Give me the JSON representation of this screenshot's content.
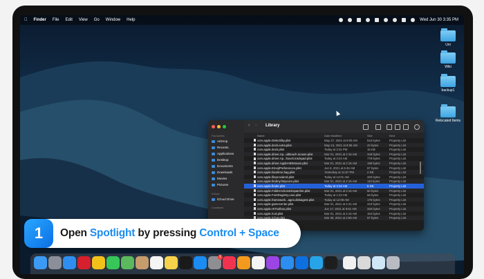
{
  "menubar": {
    "app": "Finder",
    "items": [
      "File",
      "Edit",
      "View",
      "Go",
      "Window",
      "Help"
    ],
    "clock": "Wed Jun 30  3:35 PM"
  },
  "desktop_icons": [
    {
      "label": "Uni"
    },
    {
      "label": "Wiki"
    },
    {
      "label": "backup1"
    },
    {
      "label": "Relocated Items"
    }
  ],
  "finder": {
    "title": "Library",
    "sidebar_headers": {
      "favourites": "Favourites",
      "icloud": "iCloud",
      "locations": "Locations"
    },
    "sidebar_items": [
      "AirDrop",
      "Recents",
      "Applications",
      "Desktop",
      "Documents",
      "Downloads",
      "Movies",
      "Pictures"
    ],
    "icloud_items": [
      "iCloud Drive"
    ],
    "columns": {
      "name": "Name",
      "date": "Date Modified",
      "size": "Size",
      "kind": "Kind"
    },
    "rows": [
      {
        "name": "com.apple.DiskUtility.plist",
        "date": "May 27, 2021 at 9:00 AM",
        "size": "516 bytes",
        "kind": "Property List"
      },
      {
        "name": "com.apple.dock.extra.plist",
        "date": "May 24, 2021 at 8:55 AM",
        "size": "42 bytes",
        "kind": "Property List"
      },
      {
        "name": "com.apple.dock.plist",
        "date": "Today at 3:31 PM",
        "size": "15 KB",
        "kind": "Property List"
      },
      {
        "name": "com.apple.driver.Ap...ultitouch.mouse.plist",
        "date": "Mar 01, 2021 at 2:16 AM",
        "size": "345 bytes",
        "kind": "Property List"
      },
      {
        "name": "com.apple.driver.Ap...ltouch.trackpad.plist",
        "date": "Today at 3:24 AM",
        "size": "778 bytes",
        "kind": "Property List"
      },
      {
        "name": "com.apple.driver.AppleHIDMouse.plist",
        "date": "Mar 01, 2021 at 2:16 AM",
        "size": "199 bytes",
        "kind": "Property List"
      },
      {
        "name": "com.apple.EmojiPreferences.plist",
        "date": "Jun 8, 2021 at 6:46 AM",
        "size": "97 bytes",
        "kind": "Property List"
      },
      {
        "name": "com.apple.facetime.bag.plist",
        "date": "Yesterday at 11:57 PM",
        "size": "2 KB",
        "kind": "Property List"
      },
      {
        "name": "com.apple.fileproviderd.plist",
        "date": "Today at 12:01 AM",
        "size": "320 bytes",
        "kind": "Property List"
      },
      {
        "name": "com.apple.findmy.fmipcore.plist",
        "date": "Mar 01, 2021 at 2:16 AM",
        "size": "110 bytes",
        "kind": "Property List"
      },
      {
        "name": "com.apple.finder.plist",
        "date": "Today at 3:34 AM",
        "size": "5 KB",
        "kind": "Property List",
        "selected": true
      },
      {
        "name": "com.apple.FolderActionsDispatcher.plist",
        "date": "Mar 01, 2021 at 2:16 AM",
        "size": "60 bytes",
        "kind": "Property List"
      },
      {
        "name": "com.apple.FontRegistry.user.plist",
        "date": "Today at 1:23 AM",
        "size": "68 bytes",
        "kind": "Property List"
      },
      {
        "name": "com.apple.framework...ages.diskagent.plist",
        "date": "Today at 12:08 AM",
        "size": "175 bytes",
        "kind": "Property List"
      },
      {
        "name": "com.apple.gamecenter.plist",
        "date": "Mar 01, 2021 at 2:41 AM",
        "size": "410 bytes",
        "kind": "Property List"
      },
      {
        "name": "com.apple.HIToolbox.plist",
        "date": "Jun 17, 2021 at 9:51 AM",
        "size": "325 bytes",
        "kind": "Property List"
      },
      {
        "name": "com.apple.iCal.plist",
        "date": "Mar 01, 2021 at 2:16 AM",
        "size": "164 bytes",
        "kind": "Property List"
      },
      {
        "name": "com.apple.iChat.plist",
        "date": "Mar 30, 2021 at 2:58 AM",
        "size": "97 bytes",
        "kind": "Property List"
      }
    ]
  },
  "banner": {
    "step": "1",
    "prefix": "Open ",
    "highlight1": "Spotlight",
    "middle": " by pressing ",
    "highlight2": "Control + Space"
  },
  "dock": {
    "apps": [
      {
        "icon": "finder-icon",
        "color": "#3c9af5"
      },
      {
        "icon": "launchpad-icon",
        "color": "#8a8f99"
      },
      {
        "icon": "safari-icon",
        "color": "#2f8ef0"
      },
      {
        "icon": "opera-icon",
        "color": "#d6202e"
      },
      {
        "icon": "chrome-icon",
        "color": "#f2c21b"
      },
      {
        "icon": "messages-icon",
        "color": "#36c758"
      },
      {
        "icon": "maps-icon",
        "color": "#5cb85c"
      },
      {
        "icon": "contacts-icon",
        "color": "#c69c6d"
      },
      {
        "icon": "reminders-icon",
        "color": "#f5f5f5"
      },
      {
        "icon": "notes-icon",
        "color": "#f6d34a"
      },
      {
        "icon": "appletv-icon",
        "color": "#1a1a1a"
      },
      {
        "icon": "appstore-icon",
        "color": "#1b8cf2"
      },
      {
        "icon": "system-preferences-icon",
        "color": "#8e8e93"
      },
      {
        "icon": "music-icon",
        "color": "#f2334f"
      },
      {
        "icon": "pages-icon",
        "color": "#f39a1e"
      },
      {
        "icon": "photos-icon",
        "color": "#f4f4f4"
      },
      {
        "icon": "podcasts-icon",
        "color": "#9b45e5"
      },
      {
        "icon": "mail-icon",
        "color": "#2b8ef0"
      },
      {
        "icon": "teamviewer-icon",
        "color": "#0e6fe0"
      },
      {
        "icon": "mk-icon",
        "color": "#27a4e8"
      },
      {
        "icon": "terminal-icon",
        "color": "#1e1e1e"
      },
      {
        "icon": "document-icon",
        "color": "#f0f0f0"
      },
      {
        "icon": "clipboard-icon",
        "color": "#d9d9d9"
      },
      {
        "icon": "screenshot-icon",
        "color": "#cfe6f7"
      },
      {
        "icon": "trash-icon",
        "color": "#b8bcc2"
      }
    ],
    "badge": "1"
  }
}
